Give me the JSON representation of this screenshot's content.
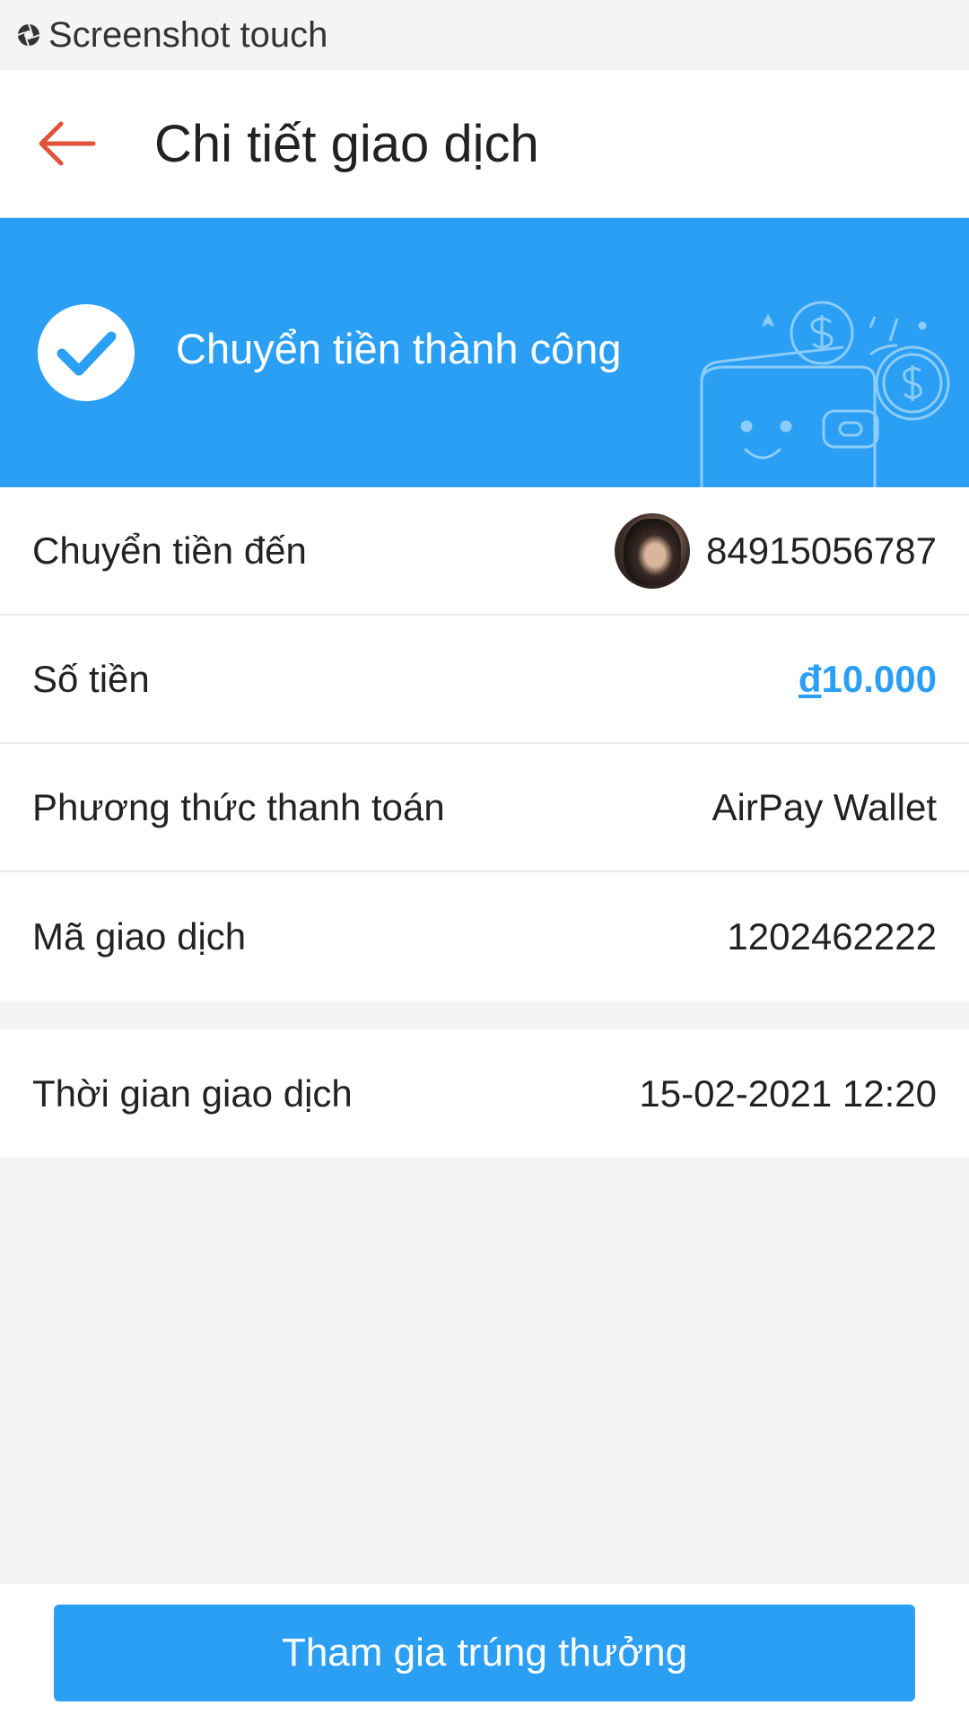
{
  "status_bar": {
    "text": "Screenshot touch",
    "icon": "camera-shutter-icon"
  },
  "header": {
    "title": "Chi tiết giao dịch",
    "back_icon": "arrow-left-icon"
  },
  "banner": {
    "message": "Chuyển tiền thành công",
    "icon": "check-circle-icon",
    "background_color": "#2b9ff4"
  },
  "details": [
    {
      "label": "Chuyển tiền đến",
      "value": "84915056787",
      "has_avatar": true
    },
    {
      "label": "Số tiền",
      "currency": "đ",
      "amount": "10.000"
    },
    {
      "label": "Phương thức thanh toán",
      "value": "AirPay Wallet"
    },
    {
      "label": "Mã giao dịch",
      "value": "1202462222"
    }
  ],
  "time_row": {
    "label": "Thời gian giao dịch",
    "value": "15-02-2021 12:20"
  },
  "footer": {
    "button_label": "Tham gia trúng thưởng"
  },
  "colors": {
    "accent": "#2b9ff4",
    "back_arrow": "#e0533a"
  }
}
